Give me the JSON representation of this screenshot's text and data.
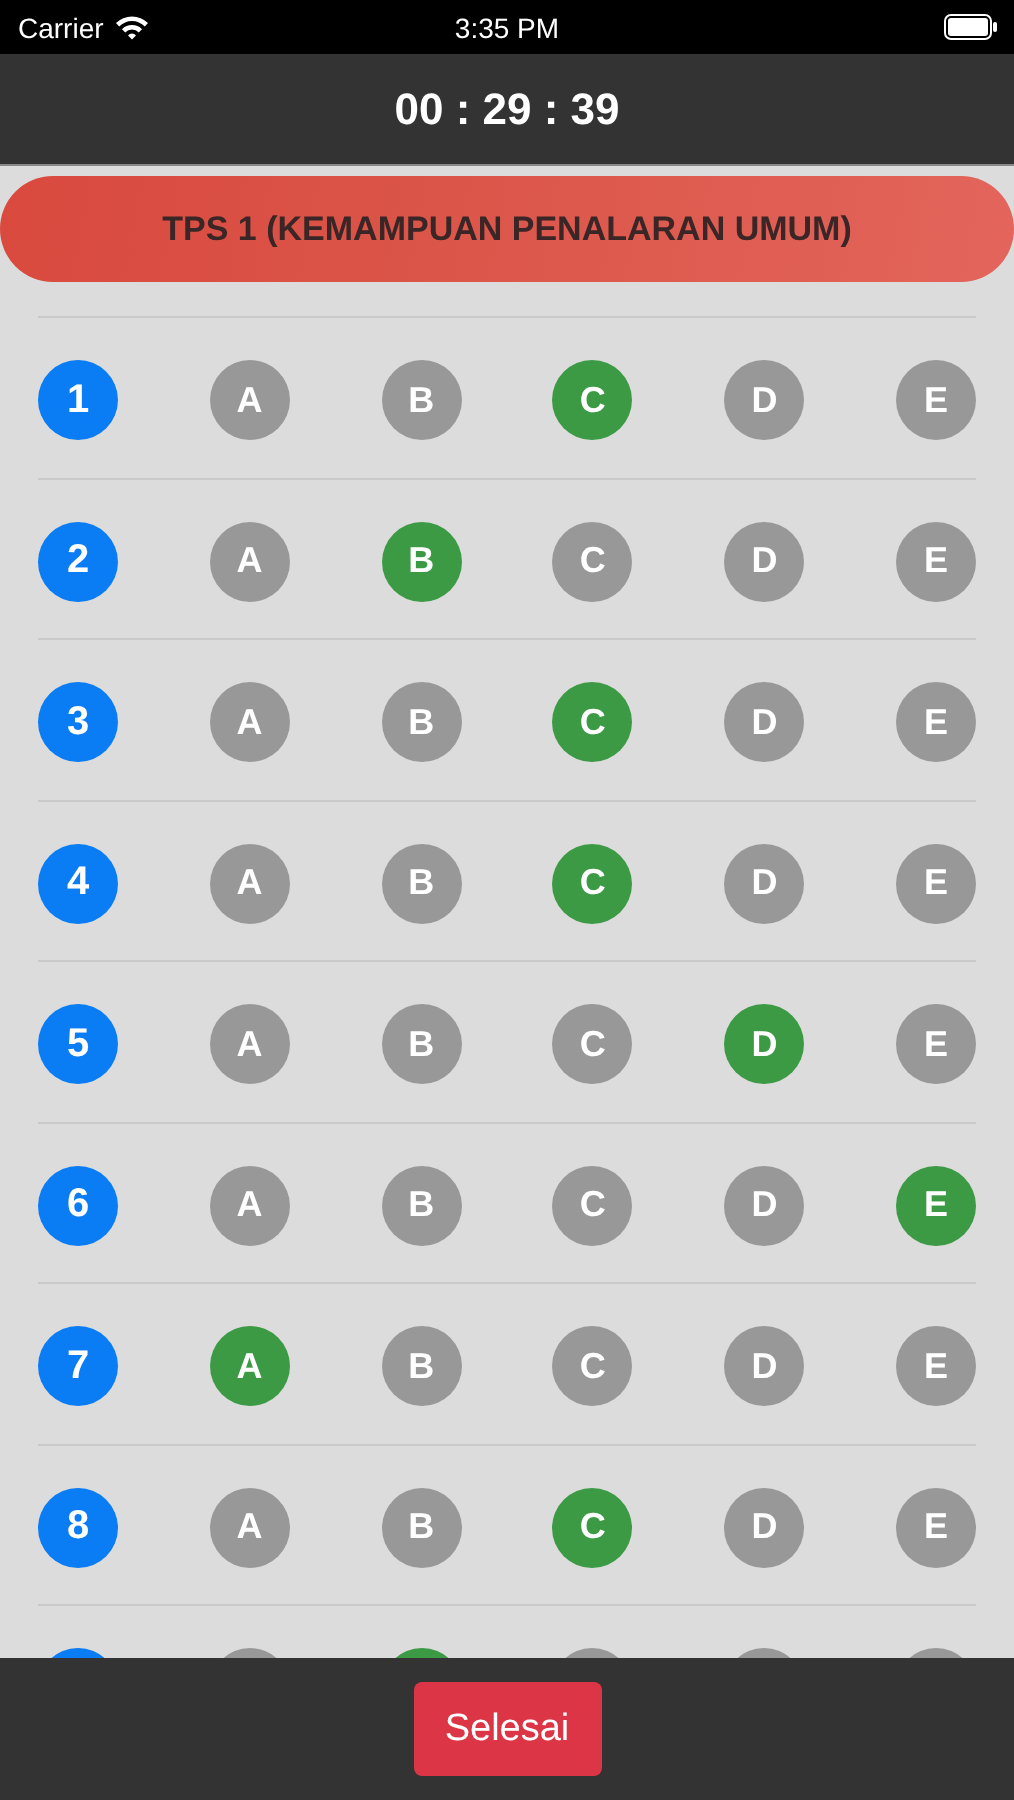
{
  "status_bar": {
    "carrier": "Carrier",
    "time": "3:35 PM"
  },
  "timer": "00 : 29 : 39",
  "section_title": "TPS 1 (KEMAMPUAN PENALARAN UMUM)",
  "questions": [
    {
      "number": "1",
      "options": [
        {
          "label": "A",
          "selected": false
        },
        {
          "label": "B",
          "selected": false
        },
        {
          "label": "C",
          "selected": true
        },
        {
          "label": "D",
          "selected": false
        },
        {
          "label": "E",
          "selected": false
        }
      ]
    },
    {
      "number": "2",
      "options": [
        {
          "label": "A",
          "selected": false
        },
        {
          "label": "B",
          "selected": true
        },
        {
          "label": "C",
          "selected": false
        },
        {
          "label": "D",
          "selected": false
        },
        {
          "label": "E",
          "selected": false
        }
      ]
    },
    {
      "number": "3",
      "options": [
        {
          "label": "A",
          "selected": false
        },
        {
          "label": "B",
          "selected": false
        },
        {
          "label": "C",
          "selected": true
        },
        {
          "label": "D",
          "selected": false
        },
        {
          "label": "E",
          "selected": false
        }
      ]
    },
    {
      "number": "4",
      "options": [
        {
          "label": "A",
          "selected": false
        },
        {
          "label": "B",
          "selected": false
        },
        {
          "label": "C",
          "selected": true
        },
        {
          "label": "D",
          "selected": false
        },
        {
          "label": "E",
          "selected": false
        }
      ]
    },
    {
      "number": "5",
      "options": [
        {
          "label": "A",
          "selected": false
        },
        {
          "label": "B",
          "selected": false
        },
        {
          "label": "C",
          "selected": false
        },
        {
          "label": "D",
          "selected": true
        },
        {
          "label": "E",
          "selected": false
        }
      ]
    },
    {
      "number": "6",
      "options": [
        {
          "label": "A",
          "selected": false
        },
        {
          "label": "B",
          "selected": false
        },
        {
          "label": "C",
          "selected": false
        },
        {
          "label": "D",
          "selected": false
        },
        {
          "label": "E",
          "selected": true
        }
      ]
    },
    {
      "number": "7",
      "options": [
        {
          "label": "A",
          "selected": true
        },
        {
          "label": "B",
          "selected": false
        },
        {
          "label": "C",
          "selected": false
        },
        {
          "label": "D",
          "selected": false
        },
        {
          "label": "E",
          "selected": false
        }
      ]
    },
    {
      "number": "8",
      "options": [
        {
          "label": "A",
          "selected": false
        },
        {
          "label": "B",
          "selected": false
        },
        {
          "label": "C",
          "selected": true
        },
        {
          "label": "D",
          "selected": false
        },
        {
          "label": "E",
          "selected": false
        }
      ]
    }
  ],
  "partial_row": {
    "options": [
      {
        "selected": false
      },
      {
        "selected": true
      },
      {
        "selected": false
      },
      {
        "selected": false
      },
      {
        "selected": false
      }
    ]
  },
  "finish_button": "Selesai"
}
